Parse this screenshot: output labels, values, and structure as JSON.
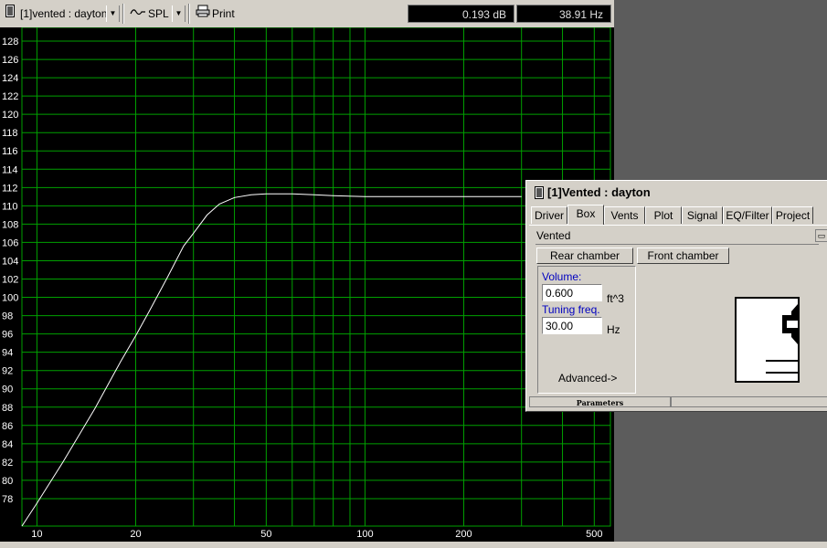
{
  "toolbar": {
    "doc_selector": "[1]vented : dayton",
    "plot_type": "SPL",
    "print_label": "Print",
    "readout_db": "0.193 dB",
    "readout_hz": "38.91 Hz"
  },
  "chart_data": {
    "type": "line",
    "x_scale": "log",
    "xlim": [
      9,
      560
    ],
    "ylim": [
      75,
      129.5
    ],
    "x_ticks": [
      10,
      20,
      50,
      100,
      200,
      500
    ],
    "x_ticklabels": [
      "10",
      "20",
      "50",
      "100",
      "200",
      "500"
    ],
    "x_grid": [
      10,
      20,
      30,
      40,
      50,
      60,
      70,
      80,
      90,
      100,
      200,
      300,
      400,
      500
    ],
    "y_ticks": [
      78,
      80,
      82,
      84,
      86,
      88,
      90,
      92,
      94,
      96,
      98,
      100,
      102,
      104,
      106,
      108,
      110,
      112,
      114,
      116,
      118,
      120,
      122,
      124,
      126,
      128
    ],
    "y_ticklabels": [
      "78",
      "80",
      "82",
      "84",
      "86",
      "88",
      "90",
      "92",
      "94",
      "96",
      "98",
      "100",
      "102",
      "104",
      "106",
      "108",
      "110",
      "112",
      "114",
      "116",
      "118",
      "120",
      "122",
      "124",
      "126",
      "128"
    ],
    "grid": true,
    "grid_color": "#00a000",
    "line_color": "#ffffff",
    "background": "#000000",
    "series": [
      {
        "x": [
          9,
          10,
          12,
          15,
          18,
          20,
          22,
          25,
          28,
          30,
          33,
          36,
          40,
          45,
          50,
          60,
          70,
          80,
          100,
          150,
          200,
          300
        ],
        "y": [
          75,
          77.5,
          82,
          87.8,
          93,
          95.8,
          98.5,
          102.2,
          105.6,
          107,
          109,
          110.2,
          110.9,
          111.2,
          111.3,
          111.3,
          111.2,
          111.1,
          111.0,
          111.0,
          111.0,
          111.0
        ]
      }
    ]
  },
  "panel": {
    "title": "[1]Vented : dayton",
    "tabs": [
      "Driver",
      "Box",
      "Vents",
      "Plot",
      "Signal",
      "EQ/Filter",
      "Project"
    ],
    "active_tab": "Box",
    "box_type": "Vented",
    "rear_chamber_label": "Rear chamber",
    "front_chamber_label": "Front chamber",
    "volume_label": "Volume:",
    "volume_value": "0.600",
    "volume_unit": "ft^3",
    "tuning_label": "Tuning freq.",
    "tuning_value": "30.00",
    "tuning_unit": "Hz",
    "advanced_label": "Advanced->",
    "status_label": "Parameters"
  }
}
